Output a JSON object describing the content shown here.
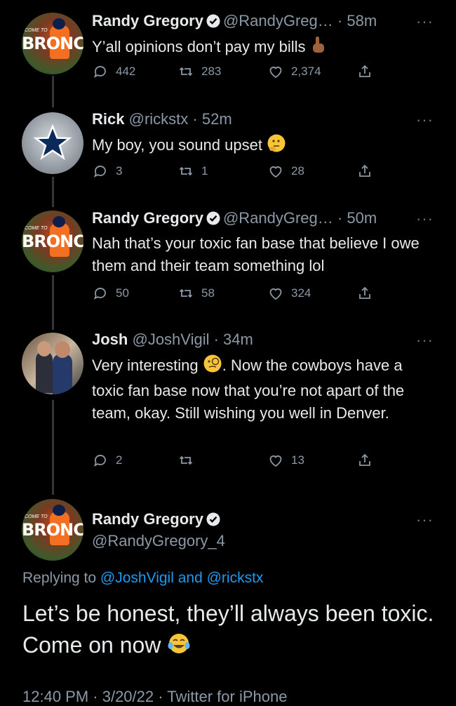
{
  "tweets": [
    {
      "name": "Randy Gregory",
      "handle": "@RandyGreg…",
      "time": "· 58m",
      "text": "Y’all opinions don’t pay my bills",
      "replies": "442",
      "retweets": "283",
      "likes": "2,374"
    },
    {
      "name": "Rick",
      "handle": "@rickstx",
      "time": "· 52m",
      "text": "My boy, you sound upset",
      "replies": "3",
      "retweets": "1",
      "likes": "28"
    },
    {
      "name": "Randy Gregory",
      "handle": "@RandyGreg…",
      "time": "· 50m",
      "text": "Nah that’s your toxic fan base that believe I owe them and their team something lol",
      "replies": "50",
      "retweets": "58",
      "likes": "324"
    },
    {
      "name": "Josh",
      "handle": "@JoshVigil",
      "time": "· 34m",
      "text_before": "Very interesting",
      "text_after": ". Now the cowboys have a toxic fan base now that you’re not apart of the team, okay. Still wishing you well in Denver.",
      "replies": "2",
      "retweets": "",
      "likes": "13"
    }
  ],
  "main_tweet": {
    "name": "Randy Gregory",
    "handle": "@RandyGregory_4",
    "replying_prefix": "Replying to",
    "replying_to": "@JoshVigil and @rickstx",
    "text": "Let’s be honest, they’ll always been toxic. Come on now",
    "footer": "12:40 PM · 3/20/22 · Twitter for iPhone"
  },
  "avatar_text": {
    "broncos": "BRONC",
    "come_to": "COME TO"
  },
  "icons": {
    "more": "···",
    "reply": "reply-icon",
    "retweet": "retweet-icon",
    "like": "heart-icon",
    "share": "share-icon",
    "verified": "verified-badge-icon"
  },
  "colors": {
    "background": "#000000",
    "text": "#e7e9ea",
    "secondary": "#8b98a5",
    "link": "#1d9bf0"
  }
}
